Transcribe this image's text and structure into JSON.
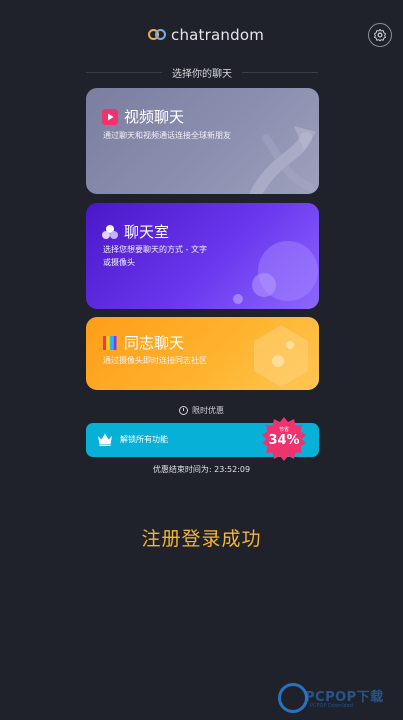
{
  "header": {
    "app_name": "chatrandom",
    "settings_icon": "settings-icon"
  },
  "section": {
    "title": "选择你的聊天"
  },
  "cards": {
    "video": {
      "title": "视频聊天",
      "desc": "通过聊天和视频通话连接全球新朋友",
      "icon": "play-icon"
    },
    "room": {
      "title": "聊天室",
      "desc_line1": "选择您想要聊天的方式 - 文字",
      "desc_line2": "或摄像头",
      "icon": "people-icon"
    },
    "gay": {
      "title": "同志聊天",
      "desc": "通过摄像头即时连接同志社区",
      "icon": "rainbow-icon"
    }
  },
  "promo": {
    "limited_label": "限时优惠",
    "unlock_label": "解锁所有功能",
    "badge_small": "节省",
    "badge_percent": "34%",
    "offer_label": "优惠结束时间为:",
    "offer_time": "23:52:09"
  },
  "status": {
    "message": "注册登录成功"
  },
  "watermark": {
    "text": "PCPOP下载",
    "sub": "PCPOP Download"
  },
  "colors": {
    "background": "#1f222b",
    "video_card": "#8e90b1",
    "room_card": "#6a37ee",
    "gay_card": "#ffb531",
    "unlock_bar": "#06b0d6",
    "badge": "#f0326e",
    "success_text": "#f4b534"
  }
}
